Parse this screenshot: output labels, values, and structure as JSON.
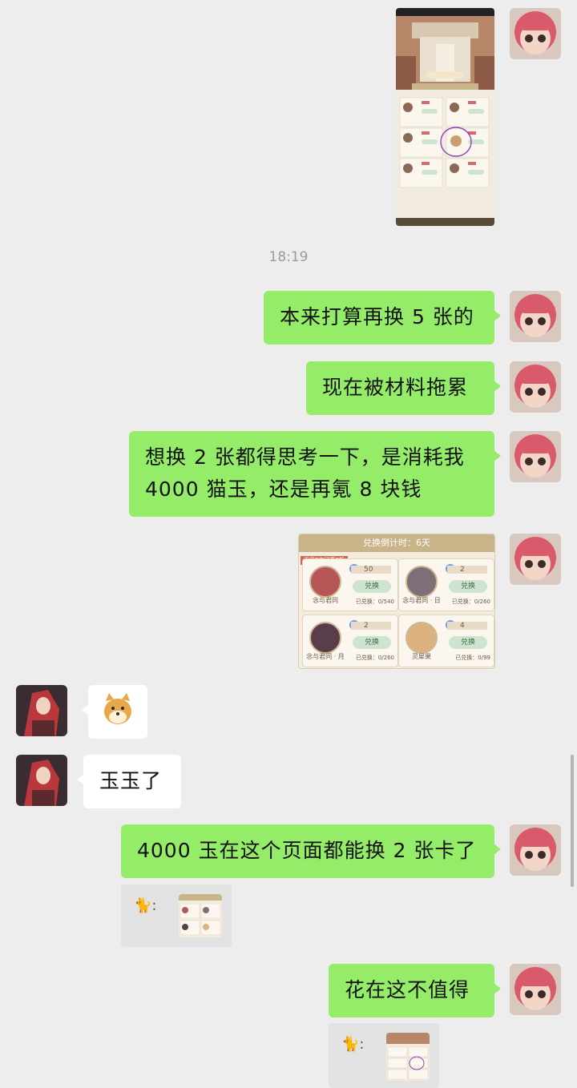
{
  "timestamp": "18:19",
  "messages": [
    {
      "side": "right",
      "text": "本来打算再换 5 张的"
    },
    {
      "side": "right",
      "text": "现在被材料拖累"
    },
    {
      "side": "right",
      "lines": [
        "想换 2 张都得思考一下，是消耗我",
        "4000 猫玉，还是再氪 8 块钱"
      ]
    },
    {
      "side": "left",
      "text": "玉玉了"
    },
    {
      "side": "right",
      "text": "4000 玉在这个页面都能换 2 张卡了"
    },
    {
      "side": "right",
      "text": "花在这不值得"
    }
  ],
  "quotes": [
    {
      "sender_icon": "🐈",
      "sep": ":"
    },
    {
      "sender_icon": "🐈",
      "sep": ":"
    }
  ],
  "exchange": {
    "countdown": "兑换倒计时：6天",
    "tag": "再买8次可享8折",
    "items": [
      {
        "name": "念与君同",
        "cost": "50",
        "button": "兑换",
        "count": "已兑换：0/540"
      },
      {
        "name": "念与君同 · 日",
        "cost": "2",
        "button": "兑换",
        "count": "已兑换：0/260"
      },
      {
        "name": "念与君同 · 月",
        "cost": "2",
        "button": "兑换",
        "count": "已兑换：0/260"
      },
      {
        "name": "灵犀果",
        "cost": "4",
        "button": "兑换",
        "count": "已兑换：0/99"
      }
    ]
  },
  "colors": {
    "bg": "#ededed",
    "green_bubble": "#95ec69",
    "white_bubble": "#ffffff"
  }
}
